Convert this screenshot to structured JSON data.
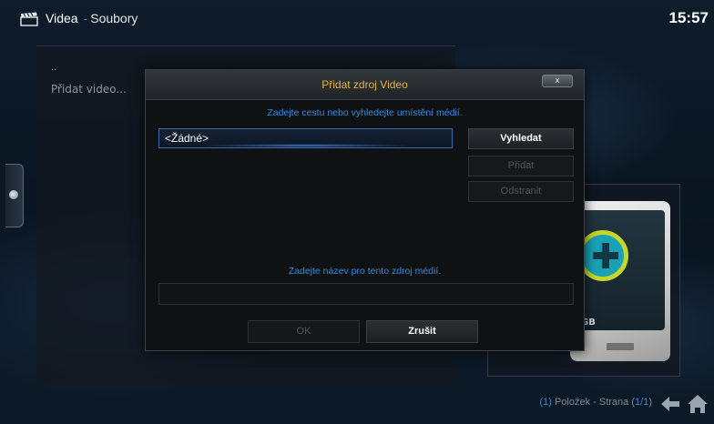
{
  "header": {
    "section": "Videa",
    "separator": "-",
    "subsection": "Soubory",
    "clock": "15:57"
  },
  "file_list": {
    "parent_marker": "..",
    "items": [
      "Přidat video..."
    ]
  },
  "thumb": {
    "label": "GB"
  },
  "dialog": {
    "title": "Přidat zdroj Video",
    "close_label": "x",
    "path_hint": "Zadejte cestu nebo vyhledejte umístění médií.",
    "path_value": "<Žádné>",
    "buttons": {
      "browse": "Vyhledat",
      "add": "Přidat",
      "remove": "Odstranit"
    },
    "name_hint": "Zadejte název pro tento zdroj médií.",
    "name_value": "",
    "ok_label": "OK",
    "cancel_label": "Zrušit"
  },
  "status": {
    "count": "(1)",
    "items_label": "Položek - Strana",
    "page_open": "(",
    "page": "1/1",
    "page_close": ")"
  },
  "colors": {
    "accent_blue": "#2e8ee6",
    "title_gold": "#e3b43a",
    "separator_blue": "#5d88c9"
  },
  "icons": {
    "app": "clapperboard-icon",
    "back": "back-arrow-icon",
    "home": "home-icon"
  }
}
